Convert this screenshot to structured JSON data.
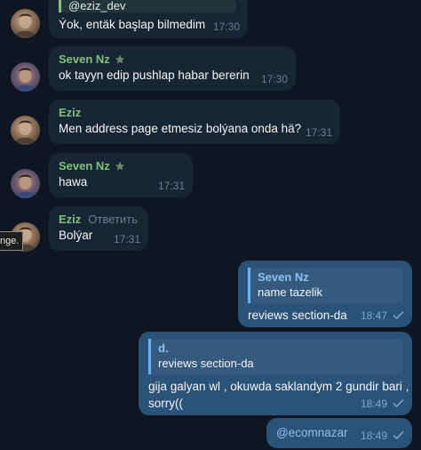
{
  "messages": [
    {
      "sender": "",
      "quote": "@eziz_dev",
      "text": "Ýok, entäk başlap bilmedim",
      "time": "17:30"
    },
    {
      "sender": "Seven Nz",
      "text": "ok tayyn edip pushlap habar bererin",
      "time": "17:30"
    },
    {
      "sender": "Eziz",
      "text": "Men address page etmesiz bolýana onda hä?",
      "time": "17:31"
    },
    {
      "sender": "Seven Nz",
      "text": "hawa",
      "time": "17:31"
    },
    {
      "sender": "Eziz",
      "reply_action": "Ответить",
      "text": "Bolýar",
      "time": "17:31"
    },
    {
      "quote_name": "Seven Nz",
      "quote_text": "name tazelik",
      "text": "reviews section-da",
      "time": "18:47"
    },
    {
      "quote_name": "d.",
      "quote_text": "reviews section-da",
      "text_line1": "gija galyan wl , okuwda saklandym 2 gundir bari ,",
      "text_line2": "sorry((",
      "time": "18:49"
    },
    {
      "text": "@ecomnazar",
      "time": "18:49"
    }
  ],
  "tooltip": "nge.",
  "colors": {
    "background": "#0e1621",
    "incoming_bubble": "#182533",
    "outgoing_bubble": "#2b5278",
    "sender_name": "#7ec27e",
    "accent": "#6ab3f3"
  },
  "icons": [
    "star-icon",
    "read-check-icon",
    "avatar"
  ]
}
